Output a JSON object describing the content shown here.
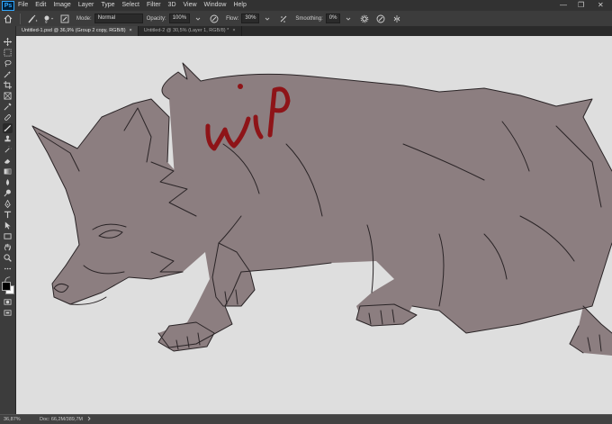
{
  "app": {
    "logo": "Ps"
  },
  "menubar": {
    "items": [
      "File",
      "Edit",
      "Image",
      "Layer",
      "Type",
      "Select",
      "Filter",
      "3D",
      "View",
      "Window",
      "Help"
    ],
    "window_controls": [
      "—",
      "❐",
      "✕"
    ]
  },
  "options": {
    "mode_label": "Mode:",
    "mode_value": "Normal",
    "opacity_label": "Opacity:",
    "opacity_value": "100%",
    "flow_label": "Flow:",
    "flow_value": "30%",
    "smoothing_label": "Smoothing:",
    "smoothing_value": "0%"
  },
  "tabs": [
    {
      "label": "Untitled-1.psd @ 36,9% (Group 2 copy, RGB/8)",
      "active": true
    },
    {
      "label": "Untitled-2 @ 30,5% (Layer 1, RGB/8) *",
      "active": false
    }
  ],
  "tab_close": "×",
  "toolbar": {
    "tools": [
      "move-icon",
      "marquee-icon",
      "lasso-icon",
      "magic-wand-icon",
      "crop-icon",
      "frame-icon",
      "eyedropper-icon",
      "healing-icon",
      "brush-icon",
      "clone-stamp-icon",
      "history-brush-icon",
      "eraser-icon",
      "gradient-icon",
      "blur-icon",
      "dodge-icon",
      "pen-icon",
      "type-icon",
      "path-select-icon",
      "rectangle-icon",
      "hand-icon",
      "zoom-icon",
      "more-icon"
    ],
    "active_tool": "brush-icon",
    "colors": {
      "foreground": "#000000",
      "background": "#ffffff"
    }
  },
  "canvas": {
    "background": "#dedede",
    "wolf_fill": "#8c7e80",
    "line_color": "#2a2426",
    "annotation_text": "wip",
    "annotation_color": "#8e1418"
  },
  "status": {
    "zoom": "36,87%",
    "doc": "Doc: 66,2M/389,7M"
  }
}
